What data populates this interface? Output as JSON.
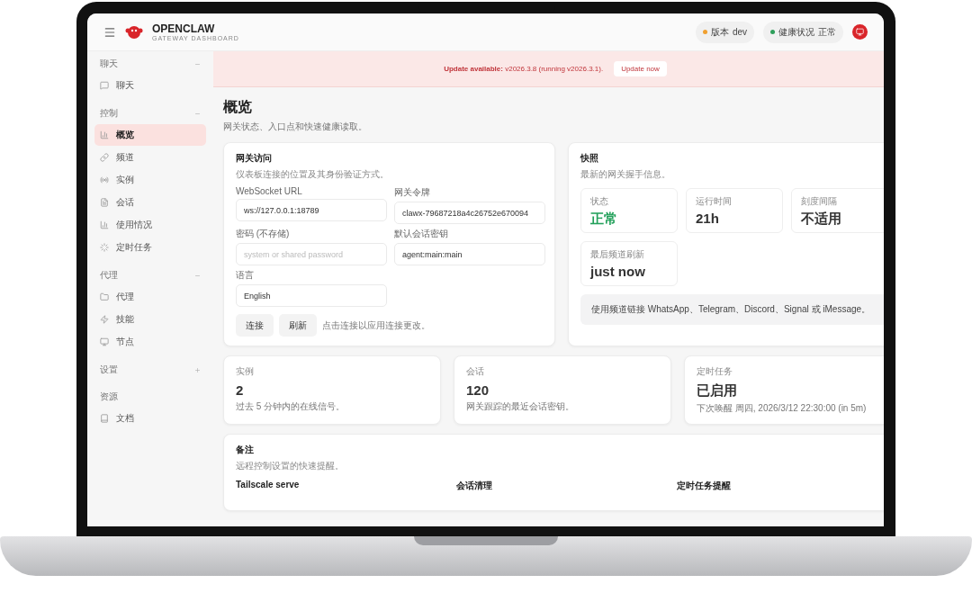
{
  "brand": {
    "name": "OPENCLAW",
    "tagline": "GATEWAY DASHBOARD"
  },
  "header_badges": [
    {
      "label": "版本",
      "value": "dev",
      "color": "#f0a030"
    },
    {
      "label": "健康状况",
      "value": "正常",
      "color": "#2e9e5b"
    }
  ],
  "sidebar": {
    "groups": [
      {
        "label": "聊天",
        "expanded": true,
        "items": [
          {
            "label": "聊天",
            "selected": false
          }
        ]
      },
      {
        "label": "控制",
        "expanded": true,
        "items": [
          {
            "label": "概览",
            "selected": true
          },
          {
            "label": "频道",
            "selected": false
          },
          {
            "label": "实例",
            "selected": false
          },
          {
            "label": "会话",
            "selected": false
          },
          {
            "label": "使用情况",
            "selected": false
          },
          {
            "label": "定时任务",
            "selected": false
          }
        ]
      },
      {
        "label": "代理",
        "expanded": true,
        "items": [
          {
            "label": "代理",
            "selected": false
          },
          {
            "label": "技能",
            "selected": false
          },
          {
            "label": "节点",
            "selected": false
          }
        ]
      },
      {
        "label": "设置",
        "expanded": false
      },
      {
        "label": "资源",
        "items": [
          {
            "label": "文档",
            "selected": false
          }
        ]
      }
    ]
  },
  "banner": {
    "text": "**Update available:** v2026.3.8 (running v2026.3.1).",
    "button": "Update now"
  },
  "page": {
    "title": "概览",
    "subtitle": "网关状态、入口点和快速健康读取。"
  },
  "access": {
    "title": "网关访问",
    "subtitle": "仪表板连接的位置及其身份验证方式。",
    "fields": [
      {
        "label": "WebSocket URL",
        "value": "ws://127.0.0.1:18789"
      },
      {
        "label": "网关令牌",
        "value": "clawx-79687218a4c26752e670094"
      },
      {
        "label": "密码 (不存储)",
        "placeholder": "system or shared password"
      },
      {
        "label": "默认会话密钥",
        "value": "agent:main:main"
      },
      {
        "label": "语言",
        "value": "English"
      }
    ],
    "buttons": [
      "连接",
      "刷新"
    ],
    "hint": "点击连接以应用连接更改。"
  },
  "snapshot": {
    "title": "快照",
    "subtitle": "最新的网关握手信息。",
    "stats": [
      {
        "label": "状态",
        "value": "正常",
        "highlight": true
      },
      {
        "label": "运行时间",
        "value": "21h",
        "highlight": false
      },
      {
        "label": "刻度间隔",
        "value": "不适用",
        "highlight": false
      },
      {
        "label": "最后频道刷新",
        "value": "just now",
        "highlight": false
      }
    ],
    "note": "使用频道链接 WhatsApp、Telegram、Discord、Signal 或 iMessage。"
  },
  "summary_cards": [
    {
      "label": "实例",
      "value": "2",
      "description": "过去 5 分钟内的在线信号。"
    },
    {
      "label": "会话",
      "value": "120",
      "description": "网关跟踪的最近会话密钥。"
    },
    {
      "label": "定时任务",
      "value": "已启用",
      "description": "下次唤醒 周四, 2026/3/12 22:30:00 (in 5m)"
    }
  ],
  "notes": {
    "title": "备注",
    "subtitle": "远程控制设置的快速提醒。",
    "columns": [
      "Tailscale serve",
      "会话清理",
      "定时任务提醒"
    ]
  }
}
